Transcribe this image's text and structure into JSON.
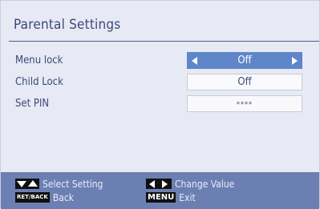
{
  "window": {
    "title": "Parental Settings"
  },
  "settings": [
    {
      "label": "Menu lock",
      "value": "Off",
      "active": true
    },
    {
      "label": "Child Lock",
      "value": "Off",
      "active": false
    },
    {
      "label": "Set PIN",
      "value": "****",
      "active": false
    }
  ],
  "footer": {
    "select_hint": "Select Setting",
    "change_hint": "Change Value",
    "back_key": "RET/BACK",
    "back_hint": "Back",
    "menu_key": "MENU",
    "exit_hint": "Exit"
  },
  "colors": {
    "panel": "#e7e9f4",
    "text": "#3a4a78",
    "highlight": "#5e86c8",
    "footer": "#6c7fb2"
  }
}
